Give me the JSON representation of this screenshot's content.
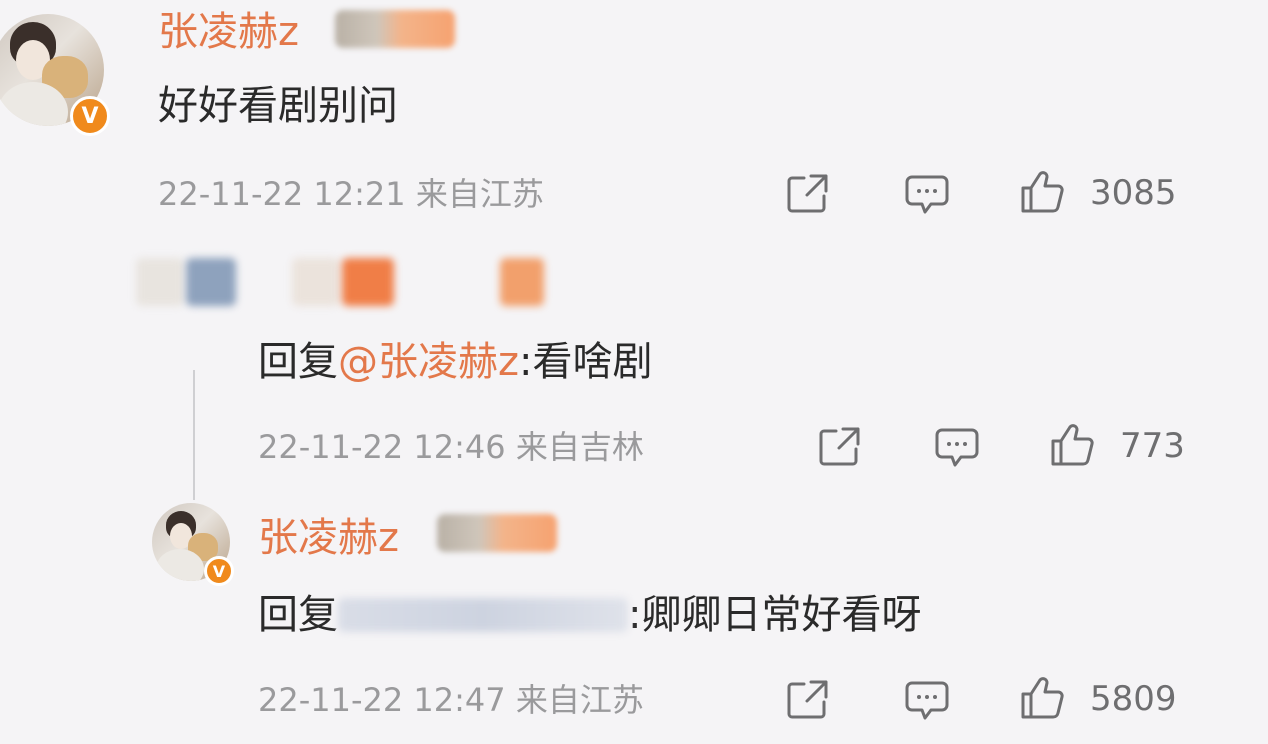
{
  "comment": {
    "username": "张凌赫z",
    "text": "好好看剧别问",
    "meta": "22-11-22 12:21 来自江苏",
    "likes": "3085"
  },
  "reply1": {
    "reply_prefix": "回复",
    "mention": "@张凌赫z",
    "text": ":看啥剧",
    "meta": "22-11-22 12:46 来自吉林",
    "likes": "773"
  },
  "reply2": {
    "username": "张凌赫z",
    "reply_prefix": "回复",
    "text": ":卿卿日常好看呀",
    "meta": "22-11-22 12:47 来自江苏",
    "likes": "5809"
  },
  "icons": {
    "share": "share-icon",
    "comment": "comment-icon",
    "like": "thumbs-up-icon",
    "verified": "verified-badge-icon"
  },
  "badge_text": "V",
  "colors": {
    "background": "#f5f4f6",
    "username": "#e3784a",
    "verified": "#f08a1c",
    "meta": "#9a9a9c"
  }
}
